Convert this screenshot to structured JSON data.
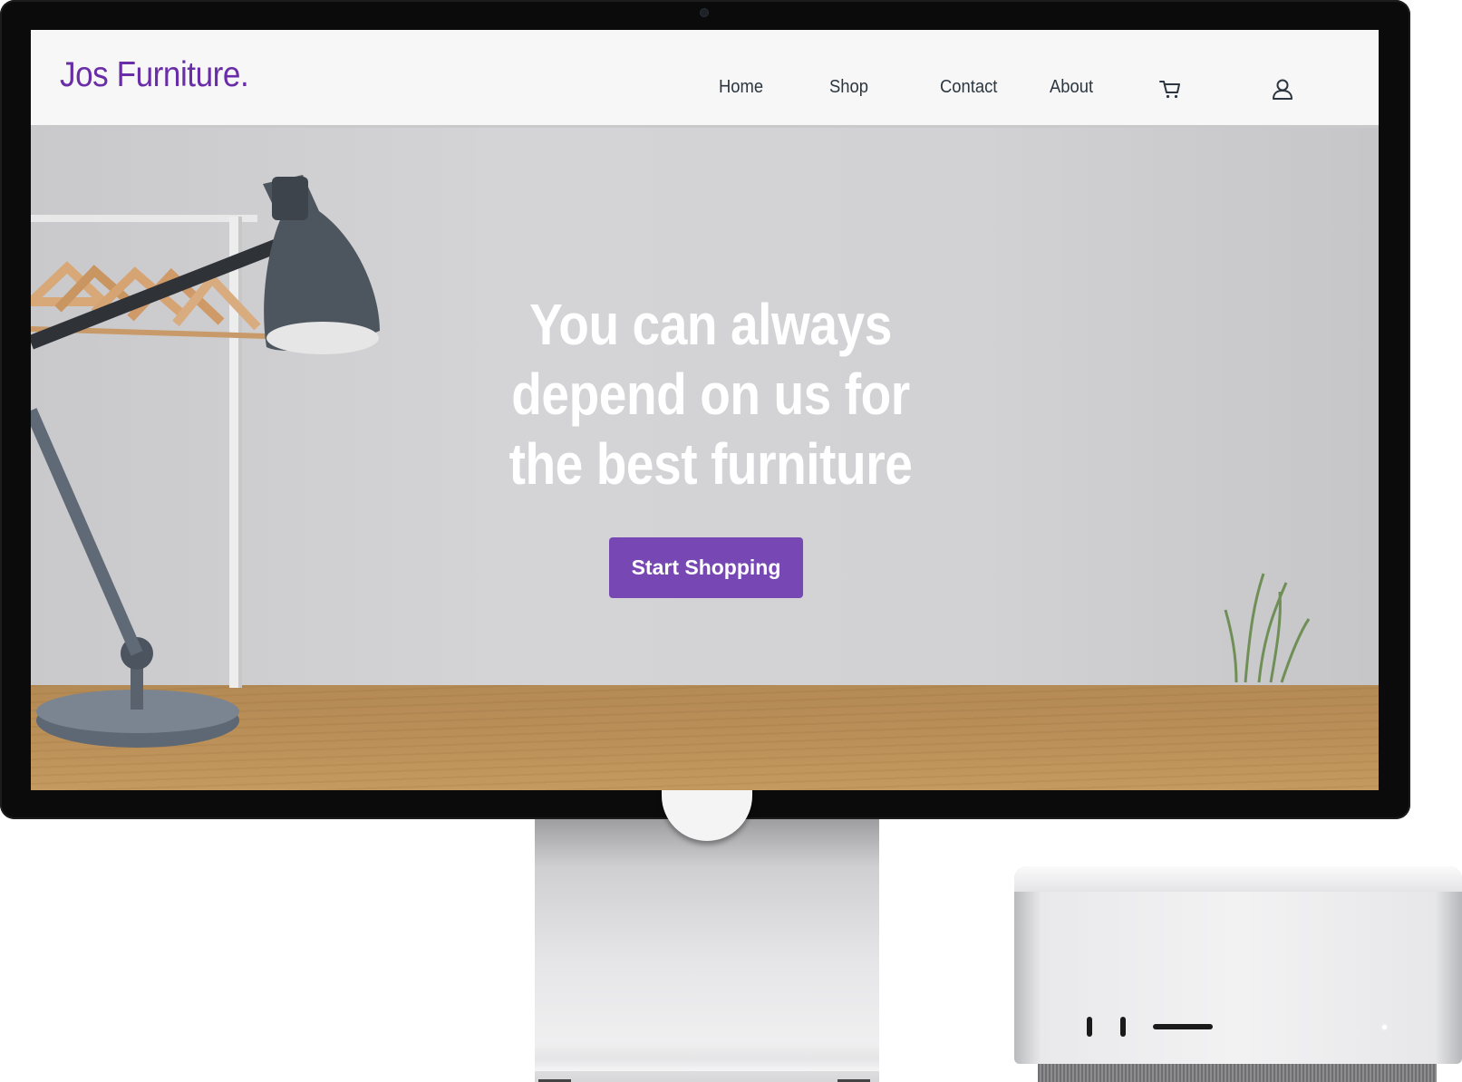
{
  "site": {
    "brand": "Jos Furniture.",
    "nav": {
      "home": "Home",
      "shop": "Shop",
      "contact": "Contact",
      "about": "About"
    },
    "icons": {
      "cart": "cart-icon",
      "account": "user-icon"
    }
  },
  "hero": {
    "heading": "You can always depend on us for the best furniture",
    "cta_label": "Start Shopping"
  },
  "colors": {
    "brand": "#6a2da8",
    "button": "#7748b4",
    "nav_text": "#2c3640",
    "navbar_bg": "#f7f7f7"
  }
}
